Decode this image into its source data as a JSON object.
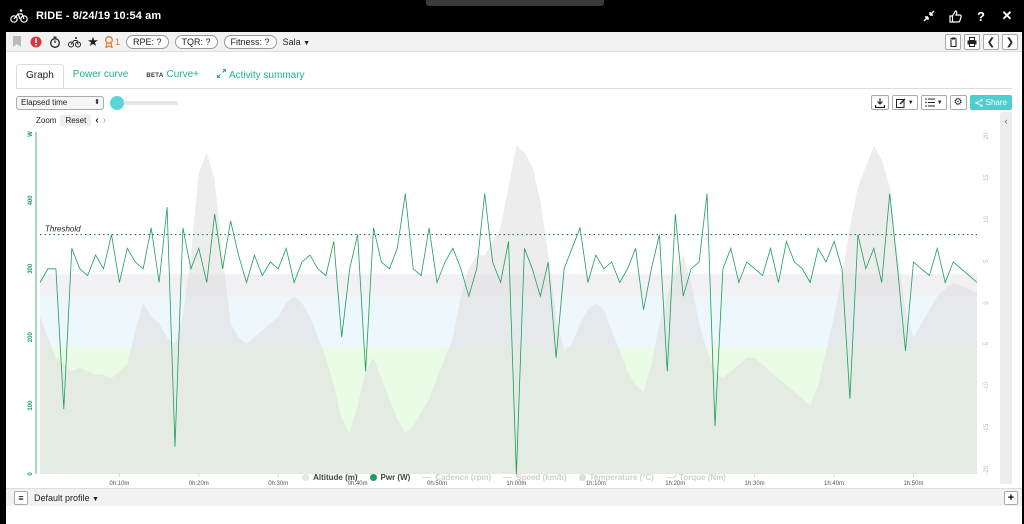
{
  "window": {
    "title": "RIDE - 8/24/19 10:54 am"
  },
  "toolbar": {
    "badge_count": "1",
    "rpe_label": "RPE: ?",
    "tqr_label": "TQR: ?",
    "fitness_label": "Fitness: ?",
    "location": "Sala",
    "title_icons": [
      "compress-icon",
      "thumbs-up-icon",
      "help-icon",
      "close-icon"
    ]
  },
  "tabs": [
    {
      "label": "Graph"
    },
    {
      "label": "Power curve"
    },
    {
      "badge": "BETA",
      "label": "Curve+"
    },
    {
      "label": "Activity summary"
    }
  ],
  "controls": {
    "x_axis_mode": "Elapsed time",
    "zoom_label": "Zoom",
    "reset_label": "Reset",
    "share_label": "Share"
  },
  "footer": {
    "profile": "Default profile"
  },
  "chart_data": {
    "type": "line",
    "xlabel": "",
    "ylabel": "",
    "x_unit": "minutes",
    "xlim": [
      0,
      118
    ],
    "x_ticks": [
      "0h:10m",
      "0h:20m",
      "0h:30m",
      "0h:40m",
      "0h:50m",
      "1h:00m",
      "1h:10m",
      "1h:20m",
      "1h:30m",
      "1h:40m",
      "1h:50m"
    ],
    "x_tick_values": [
      10,
      20,
      30,
      40,
      50,
      60,
      70,
      80,
      90,
      100,
      110
    ],
    "ylim": [
      0,
      500
    ],
    "y_ticks": [
      0,
      100,
      200,
      300,
      400
    ],
    "y_tick_top": "W",
    "y2_ticks": [
      "20",
      "15",
      "10",
      "5",
      "0",
      "-5",
      "-10",
      "-15",
      "-20"
    ],
    "threshold": {
      "label": "Threshold",
      "value": 350
    },
    "zones": [
      {
        "from": 0,
        "to": 185,
        "color": "#eafbe6"
      },
      {
        "from": 185,
        "to": 260,
        "color": "#eef7fb"
      },
      {
        "from": 260,
        "to": 292,
        "color": "#f0f0f5"
      }
    ],
    "legend": [
      {
        "name": "Altitude (m)",
        "color": "#e6e6e6",
        "marker": "dot",
        "active": true
      },
      {
        "name": "Pwr (W)",
        "color": "#1e9e5b",
        "marker": "dot",
        "active": true
      },
      {
        "name": "Cadence (rpm)",
        "color": "#dddddd",
        "marker": "line",
        "active": false
      },
      {
        "name": "Speed (km/h)",
        "color": "#dddddd",
        "marker": "line",
        "active": false
      },
      {
        "name": "Temperature (°C)",
        "color": "#dddddd",
        "marker": "dot",
        "active": false
      },
      {
        "name": "Torque (Nm)",
        "color": "#dddddd",
        "marker": "line",
        "active": false
      }
    ],
    "series": [
      {
        "name": "Altitude (m)",
        "color": "#e8e8e8",
        "x": [
          0,
          1,
          2,
          3,
          4,
          5,
          6,
          7,
          8,
          9,
          10,
          11,
          12,
          13,
          14,
          15,
          16,
          17,
          18,
          19,
          20,
          21,
          22,
          23,
          24,
          25,
          26,
          27,
          28,
          29,
          30,
          31,
          32,
          33,
          34,
          35,
          36,
          37,
          38,
          39,
          40,
          41,
          42,
          43,
          44,
          45,
          46,
          47,
          48,
          49,
          50,
          51,
          52,
          53,
          54,
          55,
          56,
          57,
          58,
          59,
          60,
          61,
          62,
          63,
          64,
          65,
          66,
          67,
          68,
          69,
          70,
          71,
          72,
          73,
          74,
          75,
          76,
          77,
          78,
          79,
          80,
          81,
          82,
          83,
          84,
          85,
          86,
          87,
          88,
          89,
          90,
          91,
          92,
          93,
          94,
          95,
          96,
          97,
          98,
          99,
          100,
          101,
          102,
          103,
          104,
          105,
          106,
          107,
          108,
          109,
          110,
          111,
          112,
          113,
          114,
          115,
          116,
          117,
          118
        ],
        "values": [
          230,
          200,
          170,
          160,
          150,
          155,
          150,
          145,
          145,
          140,
          150,
          160,
          210,
          250,
          230,
          220,
          200,
          190,
          230,
          320,
          440,
          470,
          430,
          320,
          220,
          200,
          190,
          200,
          210,
          220,
          230,
          250,
          260,
          250,
          230,
          200,
          170,
          130,
          80,
          60,
          100,
          150,
          170,
          140,
          110,
          80,
          60,
          70,
          90,
          110,
          140,
          170,
          200,
          260,
          300,
          320,
          320,
          340,
          360,
          420,
          480,
          470,
          450,
          400,
          320,
          230,
          180,
          190,
          220,
          240,
          250,
          240,
          210,
          180,
          150,
          130,
          120,
          160,
          220,
          260,
          300,
          320,
          280,
          220,
          180,
          150,
          140,
          150,
          160,
          170,
          170,
          160,
          150,
          140,
          130,
          120,
          110,
          100,
          130,
          180,
          230,
          290,
          360,
          420,
          450,
          480,
          460,
          420,
          320,
          240,
          200,
          220,
          240,
          260,
          270,
          280,
          275,
          270,
          265
        ]
      },
      {
        "name": "Pwr (W)",
        "color": "#1e9e5b",
        "x": [
          0,
          1,
          2,
          3,
          4,
          5,
          6,
          7,
          8,
          9,
          10,
          11,
          12,
          13,
          14,
          15,
          16,
          17,
          18,
          19,
          20,
          21,
          22,
          23,
          24,
          25,
          26,
          27,
          28,
          29,
          30,
          31,
          32,
          33,
          34,
          35,
          36,
          37,
          38,
          39,
          40,
          41,
          42,
          43,
          44,
          45,
          46,
          47,
          48,
          49,
          50,
          51,
          52,
          53,
          54,
          55,
          56,
          57,
          58,
          59,
          60,
          61,
          62,
          63,
          64,
          65,
          66,
          67,
          68,
          69,
          70,
          71,
          72,
          73,
          74,
          75,
          76,
          77,
          78,
          79,
          80,
          81,
          82,
          83,
          84,
          85,
          86,
          87,
          88,
          89,
          90,
          91,
          92,
          93,
          94,
          95,
          96,
          97,
          98,
          99,
          100,
          101,
          102,
          103,
          104,
          105,
          106,
          107,
          108,
          109,
          110,
          111,
          112,
          113,
          114,
          115,
          116,
          117,
          118
        ],
        "values": [
          280,
          300,
          300,
          95,
          330,
          300,
          290,
          320,
          300,
          350,
          280,
          330,
          310,
          300,
          360,
          280,
          390,
          40,
          360,
          300,
          330,
          280,
          380,
          300,
          370,
          320,
          280,
          320,
          290,
          310,
          300,
          330,
          280,
          310,
          320,
          300,
          290,
          340,
          200,
          300,
          350,
          150,
          360,
          310,
          300,
          330,
          410,
          300,
          290,
          360,
          280,
          310,
          330,
          300,
          260,
          300,
          410,
          310,
          280,
          340,
          0,
          330,
          300,
          260,
          310,
          170,
          300,
          330,
          360,
          280,
          320,
          300,
          310,
          280,
          300,
          330,
          240,
          300,
          350,
          150,
          380,
          260,
          300,
          310,
          410,
          70,
          300,
          330,
          280,
          310,
          300,
          290,
          330,
          280,
          340,
          310,
          300,
          280,
          330,
          310,
          340,
          300,
          110,
          350,
          300,
          330,
          280,
          410,
          300,
          180,
          310,
          300,
          290,
          330,
          280,
          310,
          300,
          290,
          280
        ]
      }
    ]
  }
}
